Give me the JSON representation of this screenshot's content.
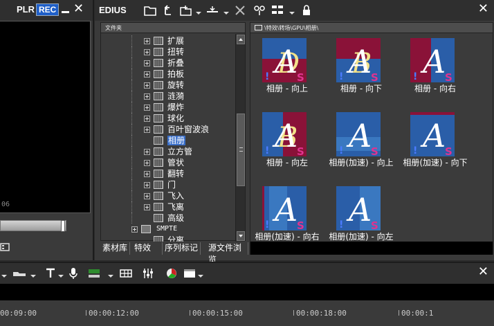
{
  "player": {
    "plr_label": "PLR",
    "rec_label": "REC",
    "timecode_partial": "06"
  },
  "bin": {
    "title": "EDIUS",
    "tree_header": "文件夹",
    "tree_items": [
      {
        "label": "扩展",
        "expand": true
      },
      {
        "label": "扭转",
        "expand": true
      },
      {
        "label": "折叠",
        "expand": true
      },
      {
        "label": "拍板",
        "expand": true
      },
      {
        "label": "旋转",
        "expand": true
      },
      {
        "label": "涟漪",
        "expand": true
      },
      {
        "label": "爆炸",
        "expand": true
      },
      {
        "label": "球化",
        "expand": true
      },
      {
        "label": "百叶窗波浪",
        "expand": true
      },
      {
        "label": "相册",
        "expand": false,
        "selected": true
      },
      {
        "label": "立方管",
        "expand": true
      },
      {
        "label": "管状",
        "expand": true
      },
      {
        "label": "翻转",
        "expand": true
      },
      {
        "label": "门",
        "expand": true
      },
      {
        "label": "飞入",
        "expand": true
      },
      {
        "label": "飞离",
        "expand": true
      },
      {
        "label": "高级",
        "expand": false
      }
    ],
    "tree_smpte": "SMPTE",
    "tree_partial": "分离",
    "tabs": [
      "素材库",
      "特效",
      "序列标记",
      "源文件浏览"
    ],
    "path": "\\特效\\转场\\GPU\\相册\\",
    "effects": [
      {
        "caption": "相册 - 向上",
        "variant": "up"
      },
      {
        "caption": "相册 - 向下",
        "variant": "down"
      },
      {
        "caption": "相册 - 向右",
        "variant": "right"
      },
      {
        "caption": "相册 - 向左",
        "variant": "left"
      },
      {
        "caption": "相册(加速) - 向上",
        "variant": "fast-up"
      },
      {
        "caption": "相册(加速) - 向下",
        "variant": "fast-down"
      },
      {
        "caption": "相册(加速) - 向右",
        "variant": "fast-right"
      },
      {
        "caption": "相册(加速) - 向左",
        "variant": "fast-left"
      }
    ],
    "thumb_colors": {
      "blue": "#2a5ea8",
      "crimson": "#8a1238",
      "accent": "#e0338f"
    }
  },
  "timeline": {
    "ruler": [
      "00:09:00",
      "00:00:12:00",
      "00:00:15:00",
      "00:00:18:00",
      "00:00:1"
    ]
  }
}
